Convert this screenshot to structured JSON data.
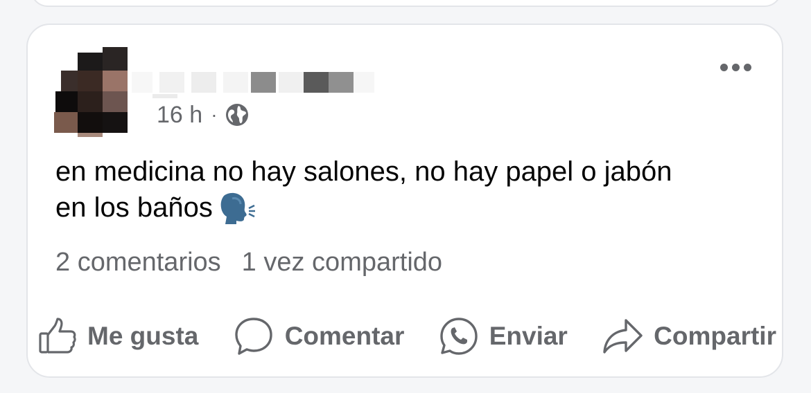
{
  "post": {
    "time": "16 h",
    "separator": "·",
    "text_line1": "en medicina no hay salones, no hay papel o jabón",
    "text_line2": "en los baños",
    "emoji_icon": "speaking-head-icon",
    "stats": {
      "comments": "2 comentarios",
      "shares": "1 vez compartido"
    },
    "actions": {
      "like": "Me gusta",
      "comment": "Comentar",
      "send": "Enviar",
      "share": "Compartir"
    }
  },
  "colors": {
    "text_primary": "#050505",
    "text_secondary": "#65676b",
    "card_border": "#e3e5e9",
    "emoji_blue": "#3d6c92"
  }
}
